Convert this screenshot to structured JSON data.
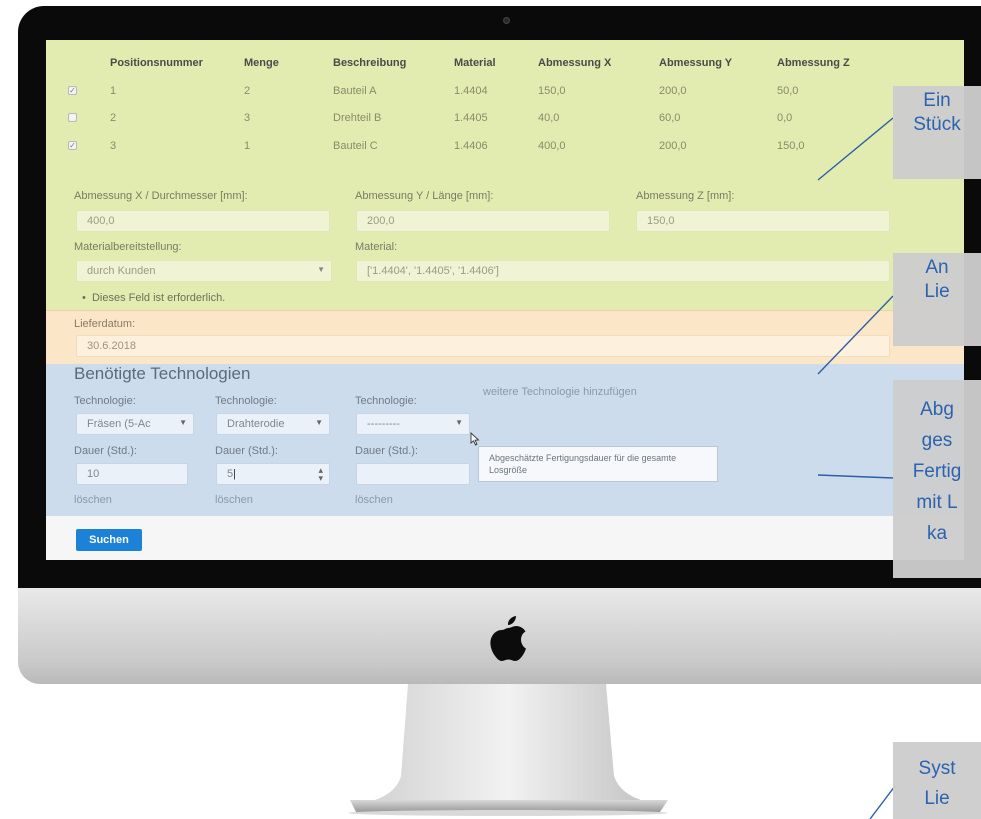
{
  "table": {
    "headers": [
      "Positionsnummer",
      "Menge",
      "Beschreibung",
      "Material",
      "Abmessung X",
      "Abmessung Y",
      "Abmessung Z"
    ],
    "rows": [
      {
        "checked": "✓",
        "pos": "1",
        "menge": "2",
        "beschreibung": "Bauteil A",
        "material": "1.4404",
        "x": "150,0",
        "y": "200,0",
        "z": "50,0"
      },
      {
        "checked": "",
        "pos": "2",
        "menge": "3",
        "beschreibung": "Drehteil B",
        "material": "1.4405",
        "x": "40,0",
        "y": "60,0",
        "z": "0,0"
      },
      {
        "checked": "✓",
        "pos": "3",
        "menge": "1",
        "beschreibung": "Bauteil C",
        "material": "1.4406",
        "x": "400,0",
        "y": "200,0",
        "z": "150,0"
      }
    ]
  },
  "form": {
    "abm_x_label": "Abmessung X / Durchmesser [mm]:",
    "abm_x_value": "400,0",
    "abm_y_label": "Abmessung Y / Länge [mm]:",
    "abm_y_value": "200,0",
    "abm_z_label": "Abmessung Z [mm]:",
    "abm_z_value": "150,0",
    "materialbereit_label": "Materialbereitstellung:",
    "materialbereit_value": "durch Kunden",
    "material_label": "Material:",
    "material_value": "['1.4404', '1.4405', '1.4406']",
    "required_note": "Dieses Feld ist erforderlich.",
    "lieferdatum_label": "Lieferdatum:",
    "lieferdatum_value": "30.6.2018"
  },
  "tech": {
    "title": "Benötigte Technologien",
    "add_link": "weitere Technologie hinzufügen",
    "columns": [
      {
        "label": "Technologie:",
        "value": "Fräsen (5-Ac",
        "dauer_label": "Dauer (Std.):",
        "dauer_value": "10",
        "delete": "löschen"
      },
      {
        "label": "Technologie:",
        "value": "Drahterodie",
        "dauer_label": "Dauer (Std.):",
        "dauer_value": "5",
        "delete": "löschen"
      },
      {
        "label": "Technologie:",
        "value": "---------",
        "dauer_label": "Dauer (Std.):",
        "dauer_value": "",
        "delete": "löschen"
      }
    ],
    "tooltip": "Abgeschätzte Fertigungsdauer für die gesamte Losgröße"
  },
  "search_button": "Suchen",
  "callouts": [
    {
      "lines": [
        "Ein",
        "Stück"
      ]
    },
    {
      "lines": [
        "An",
        "Lie"
      ]
    },
    {
      "lines": [
        "Abg",
        "ges",
        "Fertig",
        "mit L",
        "ka"
      ]
    },
    {
      "lines": [
        "Syst",
        "Lie"
      ]
    }
  ],
  "colors": {
    "green_section": "#e3ecb0",
    "orange_section": "#fbe6c7",
    "blue_section": "#cddcec",
    "button": "#1c82d8",
    "callout_text": "#2b63b0"
  }
}
